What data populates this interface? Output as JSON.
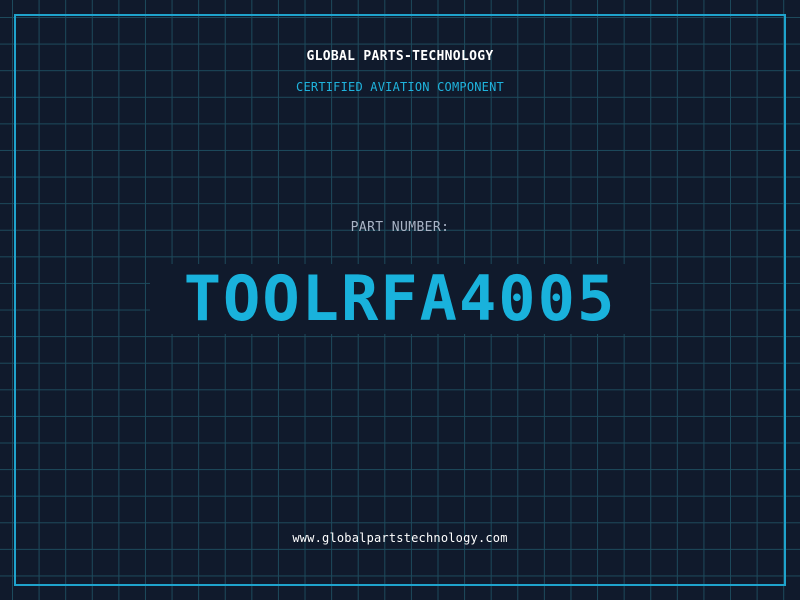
{
  "header": {
    "company_name": "GLOBAL PARTS-TECHNOLOGY",
    "tagline": "CERTIFIED AVIATION COMPONENT"
  },
  "main": {
    "part_label": "PART NUMBER:",
    "part_number": "TOOLRFA4005"
  },
  "footer": {
    "website": "www.globalpartstechnology.com"
  },
  "colors": {
    "background": "#101a2c",
    "grid": "#1d4a5c",
    "frame": "#1fa3cc",
    "accent": "#19b2dc",
    "label": "#aab4c6",
    "text": "#ffffff"
  }
}
